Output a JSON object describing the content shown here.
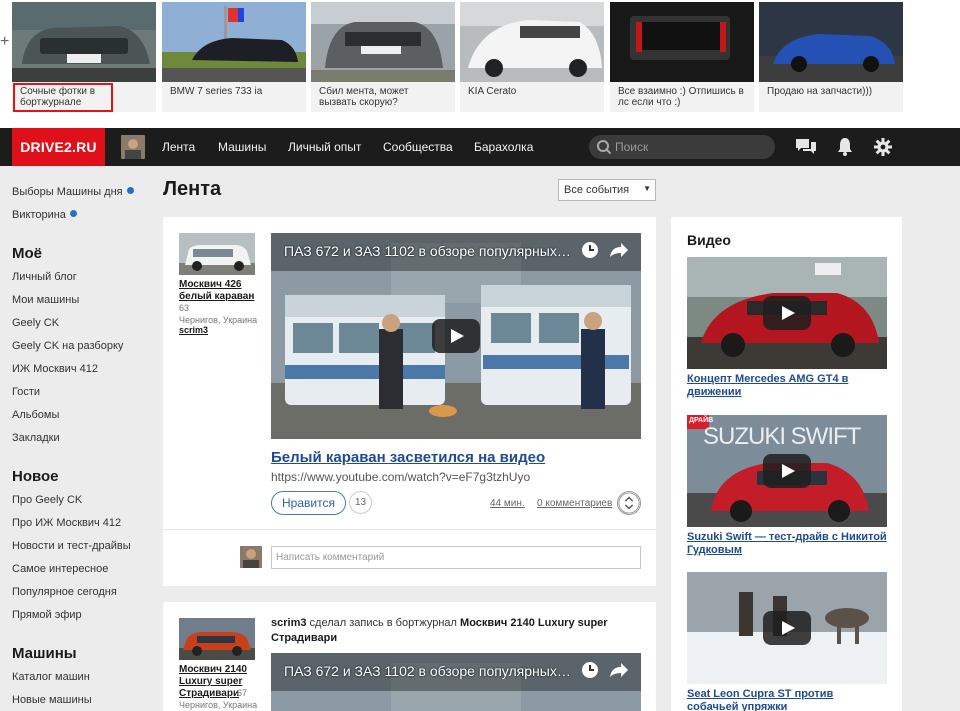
{
  "strip": {
    "cards": [
      {
        "caption": "Сочные фотки в бортжурнале"
      },
      {
        "caption": "BMW 7 series 733 ia"
      },
      {
        "caption": "Сбил мента, может вызвать скорую?"
      },
      {
        "caption": "KIA Cerato"
      },
      {
        "caption": "Все взаимно :) Отпишись в лс если что :)"
      },
      {
        "caption": "Продаю на запчасти)))"
      }
    ]
  },
  "nav": {
    "logo": "DRIVE2.RU",
    "links": [
      "Лента",
      "Машины",
      "Личный опыт",
      "Сообщества",
      "Барахолка"
    ],
    "search_placeholder": "Поиск"
  },
  "sidebar": {
    "top": [
      "Выборы Машины дня",
      "Викторина"
    ],
    "sections": [
      {
        "title": "Моё",
        "items": [
          "Личный блог",
          "Мои машины",
          "Geely CK",
          "Geely CK на разборку",
          "ИЖ Москвич 412",
          "Гости",
          "Альбомы",
          "Закладки"
        ]
      },
      {
        "title": "Новое",
        "items": [
          "Про Geely CK",
          "Про ИЖ Москвич 412",
          "Новости и тест-драйвы",
          "Самое интересное",
          "Популярное сегодня",
          "Прямой эфир"
        ]
      },
      {
        "title": "Машины",
        "items": [
          "Каталог машин",
          "Новые машины"
        ]
      }
    ]
  },
  "main": {
    "title": "Лента",
    "filter": "Все события",
    "post1": {
      "car_name": "Москвич 426 белый караван",
      "car_count": "63",
      "location": "Чернигов, Украина",
      "user": "scrim3",
      "video_title": "ПАЗ 672 и ЗАЗ 1102 в обзоре популярных т...",
      "headline": "Белый караван засветился на видео",
      "url": "https://www.youtube.com/watch?v=eF7g3tzhUyo",
      "like_label": "Нравится",
      "likes": "13",
      "time": "44 мин.",
      "comments": "0 комментариев",
      "comment_placeholder": "Написать комментарий"
    },
    "post2": {
      "car_name": "Москвич 2140 Luxury super Страдивари",
      "car_count": "67",
      "location": "Чернигов, Украина",
      "author": "scrim3",
      "action": "сделал запись в бортжурнал",
      "journal": "Москвич 2140 Luxury super Страдивари",
      "video_title": "ПАЗ 672 и ЗАЗ 1102 в обзоре популярных т..."
    }
  },
  "videos": {
    "title": "Видео",
    "items": [
      {
        "caption": "Концепт Mercedes AMG GT4 в движении"
      },
      {
        "caption": "Suzuki Swift — тест-драйв с Никитой Гудковым",
        "overlay": "SUZUKI SWIFT",
        "badge": "ДРАЙВ"
      },
      {
        "caption": "Seat Leon Cupra ST против собачьей упряжки"
      }
    ]
  }
}
